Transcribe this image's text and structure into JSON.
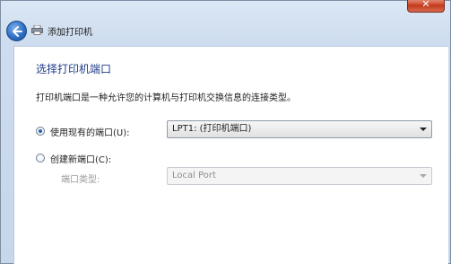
{
  "window": {
    "title": "添加打印机",
    "close_label": "✕"
  },
  "page": {
    "heading": "选择打印机端口",
    "description": "打印机端口是一种允许您的计算机与打印机交换信息的连接类型。"
  },
  "options": {
    "use_existing": {
      "label": "使用现有的端口(U):",
      "selected": true,
      "value": "LPT1: (打印机端口)"
    },
    "create_new": {
      "label": "创建新端口(C):",
      "selected": false,
      "port_type_label": "端口类型:",
      "port_type_value": "Local Port"
    }
  },
  "icons": {
    "back": "back-arrow-icon",
    "printer": "printer-icon",
    "dropdown": "chevron-down-icon"
  }
}
